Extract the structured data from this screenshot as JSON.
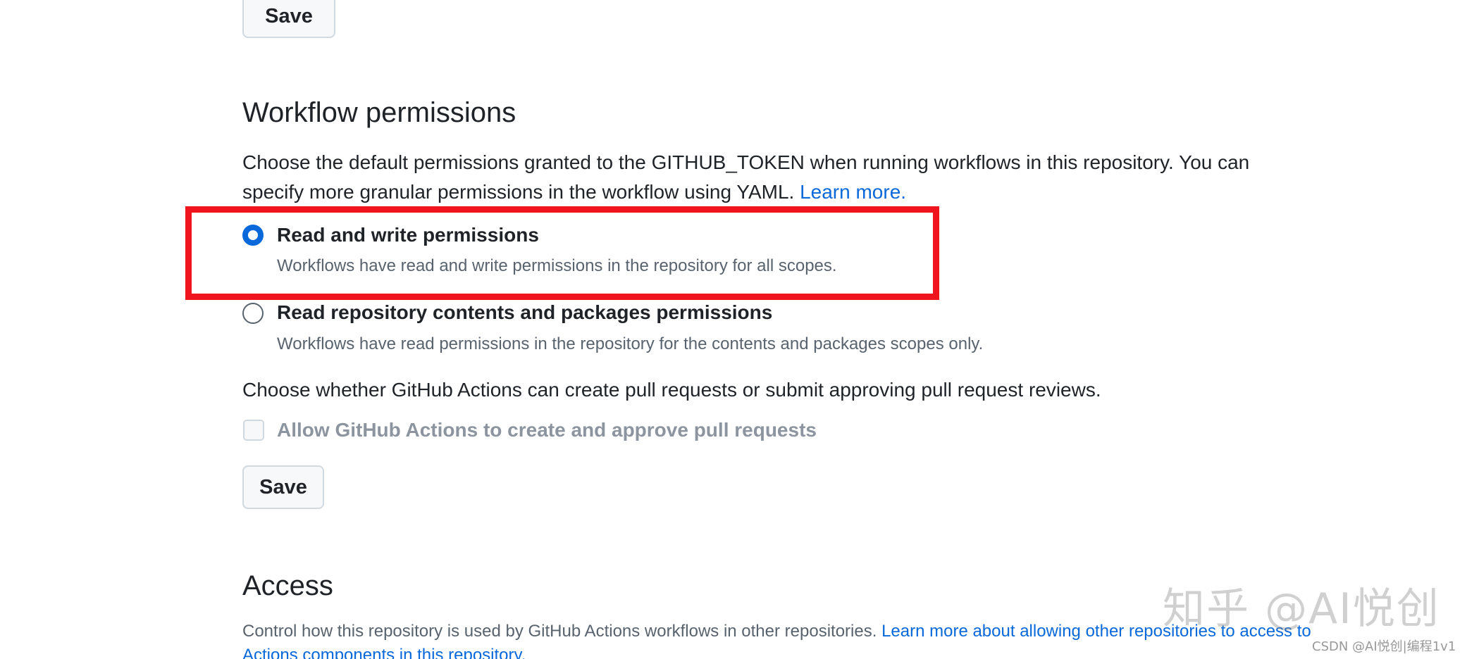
{
  "top_save": {
    "label": "Save"
  },
  "workflow_permissions": {
    "title": "Workflow permissions",
    "description": "Choose the default permissions granted to the GITHUB_TOKEN when running workflows in this repository. You can specify more granular permissions in the workflow using YAML.",
    "learn_more_label": "Learn more.",
    "options": [
      {
        "label": "Read and write permissions",
        "description": "Workflows have read and write permissions in the repository for all scopes.",
        "selected": true
      },
      {
        "label": "Read repository contents and packages permissions",
        "description": "Workflows have read permissions in the repository for the contents and packages scopes only.",
        "selected": false
      }
    ],
    "pull_request_description": "Choose whether GitHub Actions can create pull requests or submit approving pull request reviews.",
    "pull_request_checkbox": {
      "label": "Allow GitHub Actions to create and approve pull requests",
      "checked": false,
      "disabled": true
    },
    "save_label": "Save"
  },
  "access": {
    "title": "Access",
    "description": "Control how this repository is used by GitHub Actions workflows in other repositories.",
    "learn_more_label": "Learn more about allowing other repositories to access to Actions components in this repository."
  },
  "colors": {
    "accent": "#0969da",
    "highlight": "#f0141e",
    "text": "#1f2328",
    "muted": "#59636e"
  },
  "watermarks": {
    "large": "知乎 @AI悦创",
    "small": "CSDN @AI悦创|编程1v1"
  }
}
